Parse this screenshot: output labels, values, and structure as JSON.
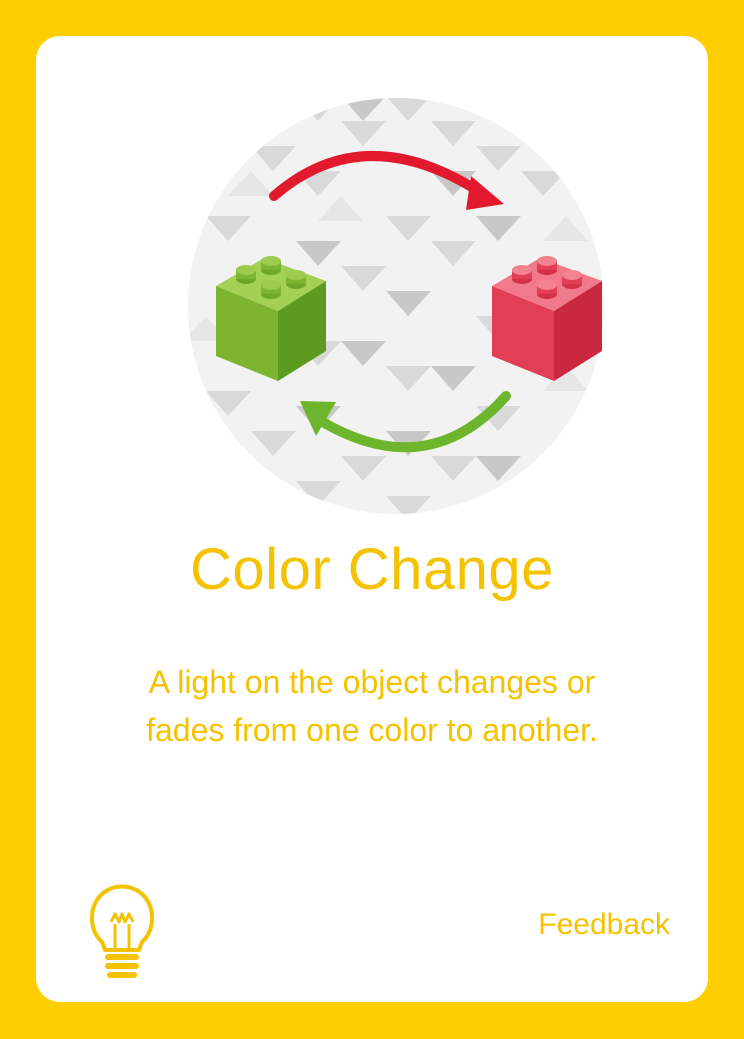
{
  "card": {
    "title": "Color Change",
    "description_line1": "A light on the object changes or",
    "description_line2": "fades from one color to another.",
    "category": "Feedback"
  },
  "icons": {
    "illustration": "color-cycle-bricks-icon",
    "category_icon": "lightbulb-icon"
  },
  "colors": {
    "background": "#FFCE00",
    "text_accent": "#F5C200",
    "arrow_red": "#E2192C",
    "arrow_green": "#6CB52D",
    "brick_green": "#8CC63F",
    "brick_red": "#E83A50"
  }
}
